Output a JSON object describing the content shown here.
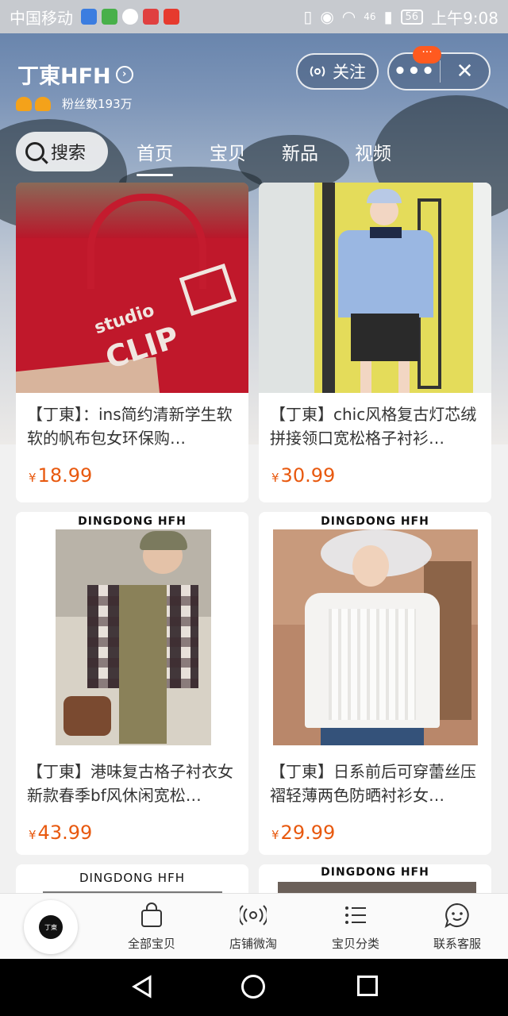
{
  "status_bar": {
    "carrier": "中国移动",
    "signal": "46",
    "battery": "56",
    "time": "上午9:08"
  },
  "shop": {
    "name": "丁東HFH",
    "fans": "粉丝数193万",
    "follow_label": "关注",
    "more_badge": "···"
  },
  "nav": {
    "search_label": "搜索",
    "tabs": [
      "首页",
      "宝贝",
      "新品",
      "视频"
    ]
  },
  "products": [
    {
      "title": "【丁東】：ins简约清新学生软软的帆布包女环保购…",
      "price": "18.99",
      "brand_text": ""
    },
    {
      "title": "【丁東】chic风格复古灯芯绒拼接领口宽松格子衬衫…",
      "price": "30.99",
      "brand_text": ""
    },
    {
      "title": "【丁東】港味复古格子衬衣女新款春季bf风休闲宽松…",
      "price": "43.99",
      "brand_text": "DINGDONG HFH"
    },
    {
      "title": "【丁東】日系前后可穿蕾丝压褶轻薄两色防晒衬衫女…",
      "price": "29.99",
      "brand_text": "DINGDONG HFH"
    },
    {
      "title": "",
      "price": "",
      "brand_text": "DINGDONG  HFH"
    },
    {
      "title": "",
      "price": "",
      "brand_text": "DINGDONG HFH"
    }
  ],
  "currency": "¥",
  "bag_print": {
    "line1": "studio",
    "line2": "CLIP"
  },
  "bottom_tabs": [
    {
      "label": "全部宝贝",
      "icon": "shopping-bag-icon"
    },
    {
      "label": "店铺微淘",
      "icon": "broadcast-icon"
    },
    {
      "label": "宝贝分类",
      "icon": "list-icon"
    },
    {
      "label": "联系客服",
      "icon": "chat-face-icon"
    }
  ],
  "logo_text": "丁東",
  "colors": {
    "price": "#e8590f",
    "badge": "#ff5a1f"
  }
}
